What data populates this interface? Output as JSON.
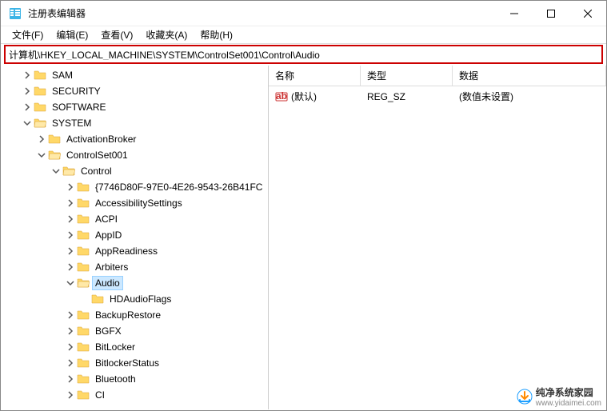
{
  "window": {
    "title": "注册表编辑器"
  },
  "menu": {
    "file": "文件(F)",
    "edit": "编辑(E)",
    "view": "查看(V)",
    "fav": "收藏夹(A)",
    "help": "帮助(H)"
  },
  "address": {
    "value": "计算机\\HKEY_LOCAL_MACHINE\\SYSTEM\\ControlSet001\\Control\\Audio"
  },
  "cols": {
    "name": "名称",
    "type": "类型",
    "data": "数据"
  },
  "vals": [
    {
      "name": "(默认)",
      "type": "REG_SZ",
      "data": "(数值未设置)",
      "icon": "ab"
    }
  ],
  "tree": {
    "sam": "SAM",
    "security": "SECURITY",
    "software": "SOFTWARE",
    "system": "SYSTEM",
    "activationbroker": "ActivationBroker",
    "controlset001": "ControlSet001",
    "control": "Control",
    "guid": "{7746D80F-97E0-4E26-9543-26B41FC",
    "accessibility": "AccessibilitySettings",
    "acpi": "ACPI",
    "appid": "AppID",
    "appreadiness": "AppReadiness",
    "arbiters": "Arbiters",
    "audio": "Audio",
    "hdaudioflags": "HDAudioFlags",
    "backuprestore": "BackupRestore",
    "bgfx": "BGFX",
    "bitlocker": "BitLocker",
    "bitlockerstatus": "BitlockerStatus",
    "bluetooth": "Bluetooth",
    "ci": "CI"
  },
  "watermark": {
    "text": "纯净系统家园",
    "url": "www.yidaimei.com"
  }
}
